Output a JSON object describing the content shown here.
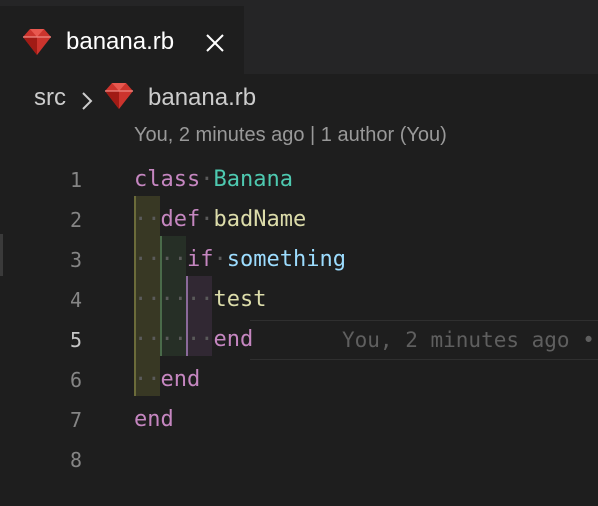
{
  "tab": {
    "filename": "banana.rb",
    "icon": "ruby-icon",
    "close_icon": "close-icon"
  },
  "breadcrumb": {
    "folder": "src",
    "separator_icon": "chevron-right-icon",
    "file_icon": "ruby-icon",
    "file": "banana.rb"
  },
  "codelens": {
    "text": "You, 2 minutes ago | 1 author (You)"
  },
  "blame": {
    "text": "You, 2 minutes ago •"
  },
  "colors": {
    "keyword": "#c586c0",
    "class": "#4ec9b0",
    "function": "#dcdcaa",
    "variable": "#9cdcfe",
    "ruby": "#cc342d"
  },
  "active_line": 5,
  "lines": [
    {
      "number": "1",
      "tokens": [
        {
          "t": "class",
          "c": "kw"
        },
        {
          "t": "·",
          "c": "dot"
        },
        {
          "t": "Banana",
          "c": "cls"
        }
      ]
    },
    {
      "number": "2",
      "tokens": [
        {
          "t": "··",
          "c": "dot"
        },
        {
          "t": "def",
          "c": "kw"
        },
        {
          "t": "·",
          "c": "dot"
        },
        {
          "t": "badName",
          "c": "fn"
        }
      ]
    },
    {
      "number": "3",
      "tokens": [
        {
          "t": "····",
          "c": "dot"
        },
        {
          "t": "if",
          "c": "kw"
        },
        {
          "t": "·",
          "c": "dot"
        },
        {
          "t": "something",
          "c": "var"
        }
      ]
    },
    {
      "number": "4",
      "tokens": [
        {
          "t": "······",
          "c": "dot"
        },
        {
          "t": "test",
          "c": "fn"
        }
      ]
    },
    {
      "number": "5",
      "tokens": [
        {
          "t": "······",
          "c": "dot"
        },
        {
          "t": "end",
          "c": "kw"
        }
      ]
    },
    {
      "number": "6",
      "tokens": [
        {
          "t": "··",
          "c": "dot"
        },
        {
          "t": "end",
          "c": "kw"
        }
      ]
    },
    {
      "number": "7",
      "tokens": [
        {
          "t": "end",
          "c": "kw"
        }
      ]
    },
    {
      "number": "8",
      "tokens": []
    }
  ]
}
